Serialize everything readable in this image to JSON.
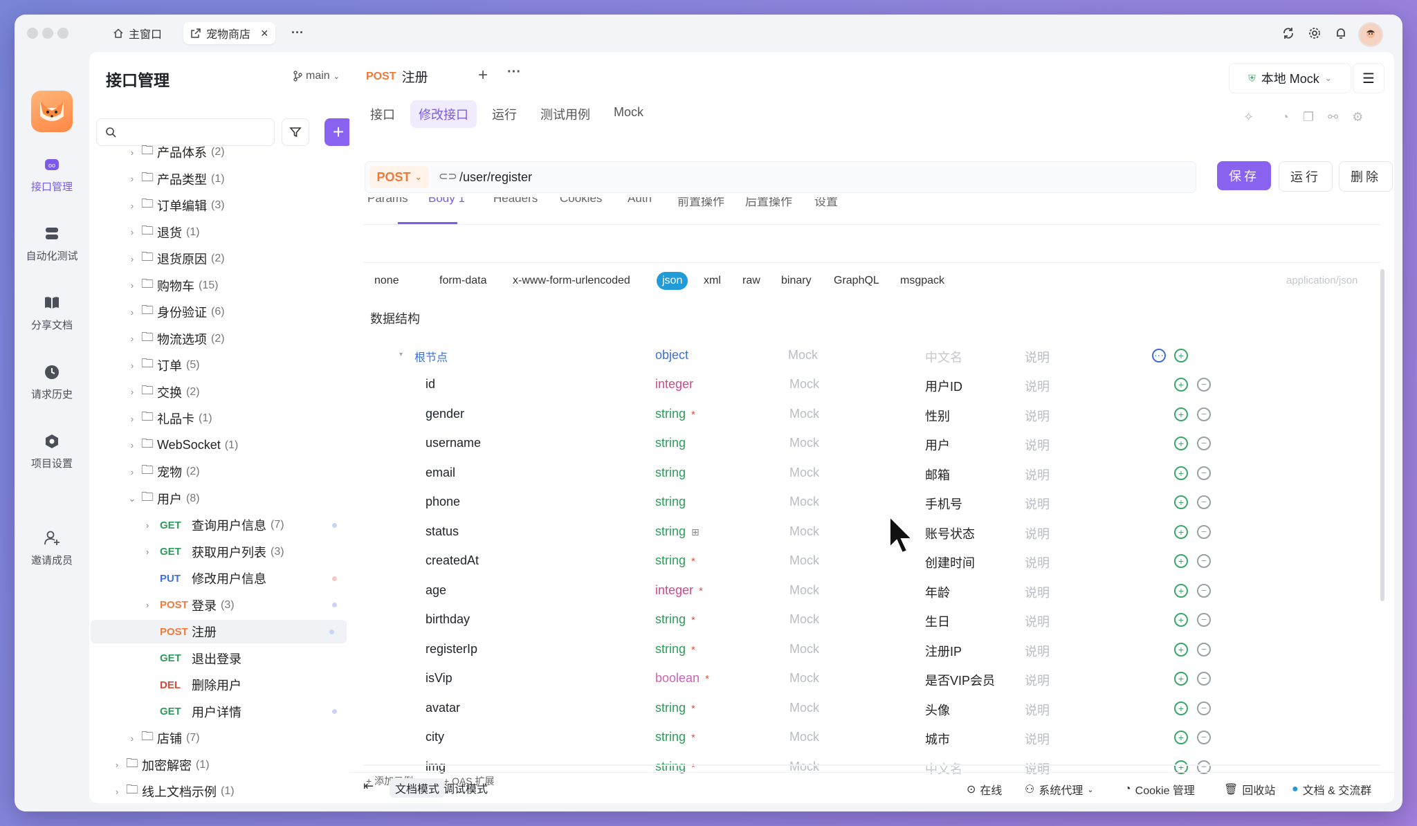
{
  "window": {
    "tabs": [
      {
        "label": "主窗口",
        "icon": "home-icon"
      },
      {
        "label": "宠物商店",
        "icon": "external-link-icon",
        "close": "×"
      }
    ],
    "more": "···"
  },
  "rail": {
    "items": [
      {
        "label": "接口管理",
        "icon": "api-icon",
        "active": true
      },
      {
        "label": "自动化测试",
        "icon": "automation-icon"
      },
      {
        "label": "分享文档",
        "icon": "book-icon"
      },
      {
        "label": "请求历史",
        "icon": "clock-icon"
      },
      {
        "label": "项目设置",
        "icon": "settings-icon"
      },
      {
        "label": "邀请成员",
        "icon": "add-user-icon"
      }
    ]
  },
  "tree": {
    "title": "接口管理",
    "branch": "main",
    "nodes": [
      {
        "label": "产品体系",
        "count": "(2)"
      },
      {
        "label": "产品类型",
        "count": "(1)"
      },
      {
        "label": "订单编辑",
        "count": "(3)"
      },
      {
        "label": "退货",
        "count": "(1)"
      },
      {
        "label": "退货原因",
        "count": "(2)"
      },
      {
        "label": "购物车",
        "count": "(15)"
      },
      {
        "label": "身份验证",
        "count": "(6)"
      },
      {
        "label": "物流选项",
        "count": "(2)"
      },
      {
        "label": "订单",
        "count": "(5)"
      },
      {
        "label": "交换",
        "count": "(2)"
      },
      {
        "label": "礼品卡",
        "count": "(1)"
      },
      {
        "label": "WebSocket",
        "count": "(1)"
      },
      {
        "label": "宠物",
        "count": "(2)"
      },
      {
        "label": "用户",
        "count": "(8)"
      },
      {
        "method": "GET",
        "label": "查询用户信息",
        "count": "(7)"
      },
      {
        "method": "GET",
        "label": "获取用户列表",
        "count": "(3)"
      },
      {
        "method": "PUT",
        "label": "修改用户信息",
        "count": ""
      },
      {
        "method": "POST",
        "label": "登录",
        "count": "(3)"
      },
      {
        "method": "POST",
        "label": "注册",
        "count": ""
      },
      {
        "method": "GET",
        "label": "退出登录",
        "count": ""
      },
      {
        "method": "DEL",
        "label": "删除用户",
        "count": ""
      },
      {
        "method": "GET",
        "label": "用户详情",
        "count": ""
      },
      {
        "label": "店铺",
        "count": "(7)"
      },
      {
        "label": "加密解密",
        "count": "(1)"
      },
      {
        "label": "线上文档示例",
        "count": "(1)"
      }
    ]
  },
  "request": {
    "method": "POST",
    "name": "注册",
    "env": "本地 Mock",
    "subtabs": [
      "接口",
      "修改接口",
      "运行",
      "测试用例",
      "Mock"
    ],
    "url": "/user/register",
    "save": "保存",
    "run": "运行",
    "delete": "删除",
    "body_tabs": [
      "Params",
      "Body 1",
      "Headers",
      "Cookies",
      "Auth",
      "前置操作",
      "后置操作",
      "设置"
    ],
    "content_types": [
      "none",
      "form-data",
      "x-www-form-urlencoded",
      "json",
      "xml",
      "raw",
      "binary",
      "GraphQL",
      "msgpack"
    ],
    "content_type_hint": "application/json",
    "section_title": "数据结构",
    "root": {
      "name": "根节点",
      "type": "object",
      "mock": "Mock",
      "cname": "中文名",
      "desc": "说明"
    },
    "fields": [
      {
        "name": "id",
        "type": "integer",
        "required": false,
        "cname": "用户ID"
      },
      {
        "name": "gender",
        "type": "string",
        "required": true,
        "cname": "性别"
      },
      {
        "name": "username",
        "type": "string",
        "required": false,
        "cname": "用户"
      },
      {
        "name": "email",
        "type": "string",
        "required": false,
        "cname": "邮箱"
      },
      {
        "name": "phone",
        "type": "string",
        "required": false,
        "cname": "手机号"
      },
      {
        "name": "status",
        "type": "string",
        "required": false,
        "enum": true,
        "cname": "账号状态"
      },
      {
        "name": "createdAt",
        "type": "string",
        "required": true,
        "cname": "创建时间"
      },
      {
        "name": "age",
        "type": "integer",
        "required": true,
        "cname": "年龄"
      },
      {
        "name": "birthday",
        "type": "string",
        "required": true,
        "cname": "生日"
      },
      {
        "name": "registerIp",
        "type": "string",
        "required": true,
        "cname": "注册IP"
      },
      {
        "name": "isVip",
        "type": "boolean",
        "required": true,
        "cname": "是否VIP会员"
      },
      {
        "name": "avatar",
        "type": "string",
        "required": true,
        "cname": "头像"
      },
      {
        "name": "city",
        "type": "string",
        "required": true,
        "cname": "城市"
      },
      {
        "name": "img",
        "type": "string",
        "required": true,
        "cname": "中文名"
      }
    ],
    "mock_placeholder": "Mock",
    "desc_placeholder": "说明",
    "add_example": "+ 添加示例",
    "oas_ext": "+ OAS 扩展"
  },
  "footer": {
    "doc_mode": "文档模式",
    "debug_mode": "调试模式",
    "online": "在线",
    "proxy": "系统代理",
    "cookie": "Cookie 管理",
    "trash": "回收站",
    "docs": "文档 & 交流群"
  },
  "colors": {
    "accent": "#8a62f0",
    "post": "#f07a3a",
    "get": "#2e9b5a",
    "put": "#3d6fd6",
    "del": "#d94a3a"
  }
}
